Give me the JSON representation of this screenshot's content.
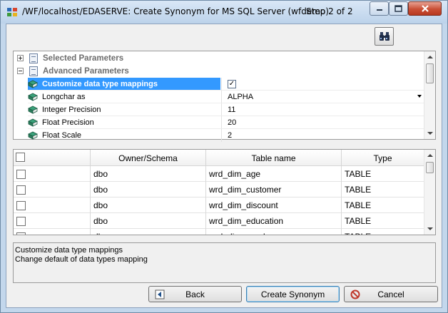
{
  "window": {
    "title": "/WF/localhost/EDASERVE: Create Synonym for MS SQL Server (wfdemo)",
    "step": "Step 2 of 2"
  },
  "toolbar": {
    "find_icon": "binoculars-icon"
  },
  "properties": {
    "sections": [
      {
        "label": "Selected Parameters",
        "expanded": false
      },
      {
        "label": "Advanced Parameters",
        "expanded": true
      }
    ],
    "rows": [
      {
        "name": "Customize data type mappings",
        "value": "",
        "checked": true,
        "selected": true
      },
      {
        "name": "Longchar as",
        "value": "ALPHA",
        "dropdown": true
      },
      {
        "name": "Integer Precision",
        "value": "11"
      },
      {
        "name": "Float Precision",
        "value": "20"
      },
      {
        "name": "Float Scale",
        "value": "2"
      }
    ]
  },
  "table": {
    "columns": [
      "",
      "Owner/Schema",
      "Table name",
      "Type"
    ],
    "rows": [
      {
        "owner": "dbo",
        "table": "wrd_dim_age",
        "type": "TABLE"
      },
      {
        "owner": "dbo",
        "table": "wrd_dim_customer",
        "type": "TABLE"
      },
      {
        "owner": "dbo",
        "table": "wrd_dim_discount",
        "type": "TABLE"
      },
      {
        "owner": "dbo",
        "table": "wrd_dim_education",
        "type": "TABLE"
      },
      {
        "owner": "dbo",
        "table": "wrd_dim_gender",
        "type": "TABLE"
      }
    ]
  },
  "description": {
    "title": "Customize data type mappings",
    "text": "Change default of data types mapping"
  },
  "buttons": {
    "back": "Back",
    "create": "Create Synonym",
    "cancel": "Cancel"
  },
  "colors": {
    "selection": "#3399ff",
    "window_frame": "#c3d7ec",
    "close_button": "#c94f35"
  }
}
